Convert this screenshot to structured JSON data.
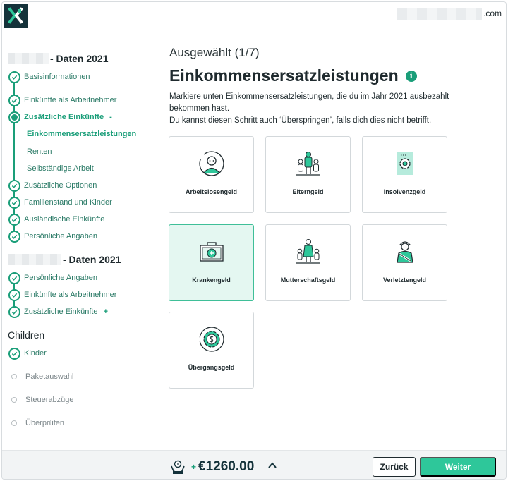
{
  "topbar": {
    "email_suffix": ".com"
  },
  "sidebar": {
    "section1_title": "- Daten 2021",
    "section1_items": [
      {
        "label": "Basisinformationen"
      },
      {
        "label": "Einkünfte als Arbeitnehmer"
      },
      {
        "label": "Zusätzliche Einkünfte",
        "toggle": "-"
      },
      {
        "label": "Zusätzliche Optionen"
      },
      {
        "label": "Familienstand und Kinder"
      },
      {
        "label": "Ausländische Einkünfte"
      },
      {
        "label": "Persönliche Angaben"
      }
    ],
    "subitems": [
      {
        "label": "Einkommensersatzleistungen"
      },
      {
        "label": "Renten"
      },
      {
        "label": "Selbständige Arbeit"
      }
    ],
    "section2_title": "- Daten 2021",
    "section2_items": [
      {
        "label": "Persönliche Angaben"
      },
      {
        "label": "Einkünfte als Arbeitnehmer"
      },
      {
        "label": "Zusätzliche Einkünfte",
        "toggle": "+"
      }
    ],
    "section3_title": "Children",
    "section3_items": [
      {
        "label": "Kinder"
      }
    ],
    "pending_items": [
      {
        "label": "Paketauswahl"
      },
      {
        "label": "Steuerabzüge"
      },
      {
        "label": "Überprüfen"
      }
    ]
  },
  "main": {
    "selected_count": "Ausgewählt (1/7)",
    "title": "Einkommensersatzleistungen",
    "info_icon": "i",
    "desc_line1": "Markiere unten Einkommensersatzleistungen, die du im Jahr 2021 ausbezahlt bekommen hast.",
    "desc_line2": "Du kannst diesen Schritt auch ‘Überspringen’, falls dich dies nicht betrifft.",
    "cards": [
      {
        "label": "Arbeitslosengeld",
        "icon": "unemployed-person-icon",
        "selected": false
      },
      {
        "label": "Elterngeld",
        "icon": "family-icon",
        "selected": false
      },
      {
        "label": "Insolvenzgeld",
        "icon": "document-gear-icon",
        "selected": false
      },
      {
        "label": "Krankengeld",
        "icon": "medical-case-icon",
        "selected": true
      },
      {
        "label": "Mutterschaftsgeld",
        "icon": "mother-children-icon",
        "selected": false
      },
      {
        "label": "Verletztengeld",
        "icon": "injured-worker-icon",
        "selected": false
      },
      {
        "label": "Übergangsgeld",
        "icon": "money-gear-icon",
        "selected": false
      }
    ]
  },
  "footer": {
    "refund_sign": "+",
    "refund_amount": "€1260.00",
    "back_label": "Zurück",
    "next_label": "Weiter"
  },
  "colors": {
    "accent": "#1a9e79",
    "button_green": "#2ec79a",
    "dark": "#14323a",
    "selected_card_bg": "#e4f7f1"
  }
}
